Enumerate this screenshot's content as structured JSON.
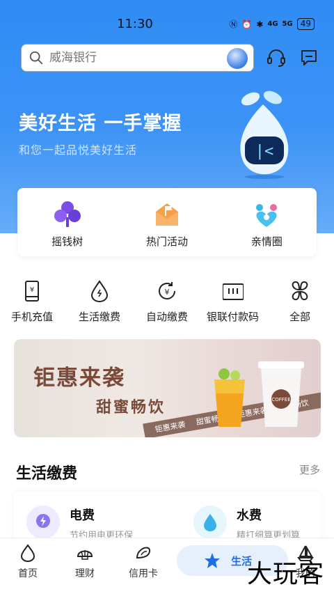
{
  "status_bar": {
    "time": "11:30",
    "signal_1": "4G",
    "signal_2": "5G",
    "battery": "49"
  },
  "header": {
    "search_placeholder": "威海银行"
  },
  "hero": {
    "title": "美好生活 一手掌握",
    "subtitle": "和您一起品悦美好生活"
  },
  "quick_actions": [
    {
      "label": "摇钱树",
      "icon": "clover-icon"
    },
    {
      "label": "热门活动",
      "icon": "flag-envelope-icon"
    },
    {
      "label": "亲情圈",
      "icon": "family-heart-icon"
    }
  ],
  "services": [
    {
      "label": "手机充值",
      "icon": "phone-topup-icon"
    },
    {
      "label": "生活缴费",
      "icon": "utility-drop-icon"
    },
    {
      "label": "自动缴费",
      "icon": "auto-pay-icon"
    },
    {
      "label": "银联付款码",
      "icon": "unionpay-code-icon"
    },
    {
      "label": "全部",
      "icon": "all-apps-icon"
    }
  ],
  "banner": {
    "title": "钜惠来袭",
    "subtitle": "甜蜜畅饮",
    "ribbon": [
      "钜惠来袭",
      "甜蜜畅饮",
      "钜惠来袭",
      "甜蜜畅饮"
    ],
    "cup_label": "COFFEE"
  },
  "bill_section": {
    "title": "生活缴费",
    "more": "更多",
    "items": [
      {
        "name": "电费",
        "desc": "节约用电更环保"
      },
      {
        "name": "水费",
        "desc": "精打细算更划算"
      }
    ]
  },
  "tab_bar": {
    "tabs": [
      {
        "label": "首页"
      },
      {
        "label": "理财"
      },
      {
        "label": "信用卡"
      },
      {
        "label": "生活"
      },
      {
        "label": "我的"
      }
    ]
  },
  "watermark": "大玩客",
  "colors": {
    "hero_blue": "#2f8cf4",
    "active_tab": "#1f6fe0"
  }
}
